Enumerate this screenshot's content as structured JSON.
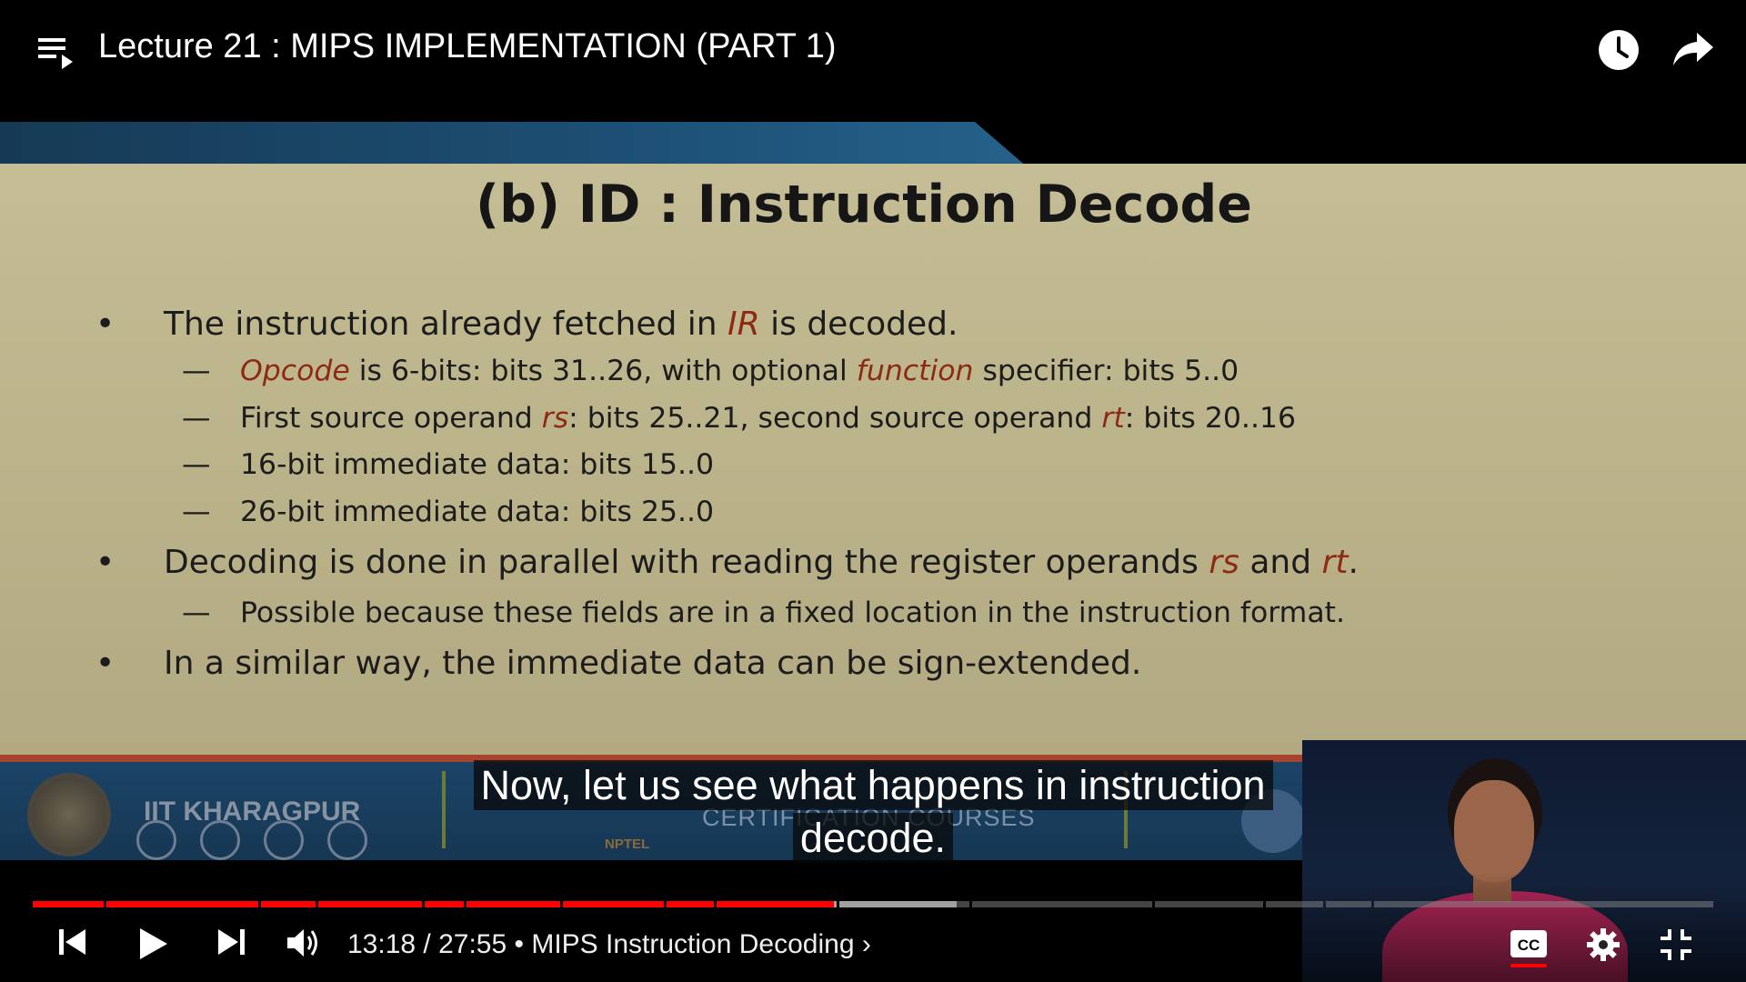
{
  "player": {
    "title": "Lecture 21 : MIPS IMPLEMENTATION (PART 1)",
    "time_current": "13:18",
    "time_total": "27:55",
    "time_display": "13:18 / 27:55",
    "chapter": "• MIPS Instruction Decoding",
    "chapter_chevron": "›",
    "progress_fraction": 0.477,
    "buffered_fraction": 0.55,
    "accent_color": "#ff0000",
    "icons": {
      "playlist": "playlist-icon",
      "watch_later": "clock-icon",
      "share": "share-arrow-icon",
      "previous": "skip-previous-icon",
      "play": "play-icon",
      "next": "skip-next-icon",
      "volume": "volume-icon",
      "captions": "cc-icon",
      "settings": "gear-icon",
      "exit_fullscreen": "exit-fullscreen-icon"
    }
  },
  "captions": {
    "line1": "Now, let us see what happens in instruction",
    "line2": "decode."
  },
  "slide": {
    "title": "(b) ID : Instruction Decode",
    "bullet_mark": "•",
    "dash_mark": "—",
    "b1_pre": "The instruction already fetched in ",
    "b1_ir": "IR",
    "b1_post": " is decoded.",
    "s1_opcode": "Opcode",
    "s1_mid": " is 6-bits: bits 31..26, with optional ",
    "s1_function": "function",
    "s1_post": " specifier: bits 5..0",
    "s2_pre": "First source operand ",
    "s2_rs": "rs",
    "s2_mid": ": bits 25..21, second source operand ",
    "s2_rt": "rt",
    "s2_post": ": bits 20..16",
    "s3": "16-bit immediate data: bits 15..0",
    "s4": "26-bit immediate data: bits 25..0",
    "b2_pre": "Decoding is done in parallel with reading the register operands ",
    "b2_rs": "rs",
    "b2_and": " and ",
    "b2_rt": "rt",
    "b2_post": ".",
    "s5": "Possible because these fields are in a fixed location in the instruction format.",
    "b3": "In a similar way, the immediate data can be sign-extended.",
    "footer_institute": "IIT KHARAGPUR",
    "footer_nptel": "NPTEL",
    "footer_cert": "CERTIFICATION COURSES"
  }
}
